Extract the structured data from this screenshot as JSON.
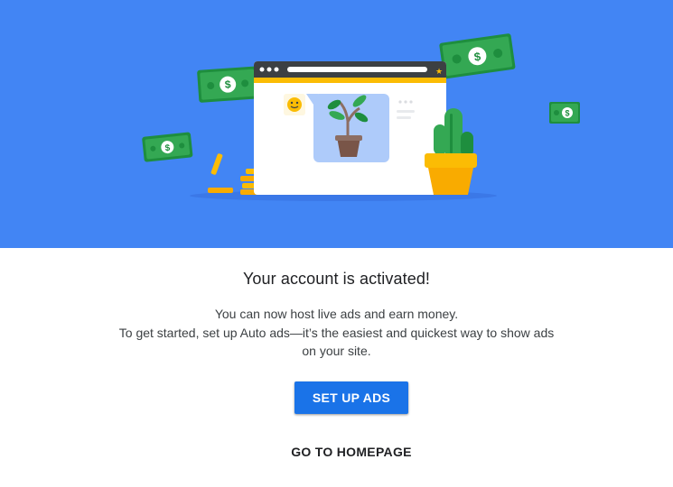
{
  "hero": {
    "illustration": "browser-window-with-plant-cactus-money-coins",
    "colors": {
      "background": "#4285f4",
      "money": "#34a853",
      "coin": "#fbbc04",
      "browser_frame": "#3c4043"
    },
    "money_symbol": "$"
  },
  "activation": {
    "title": "Your account is activated!",
    "line1": "You can now host live ads and earn money.",
    "line2": "To get started, set up Auto ads—it’s the easiest and quickest way to show ads",
    "line3": "on your site."
  },
  "actions": {
    "primary_label": "SET UP ADS",
    "secondary_label": "GO TO HOMEPAGE",
    "primary_color": "#1a73e8"
  }
}
